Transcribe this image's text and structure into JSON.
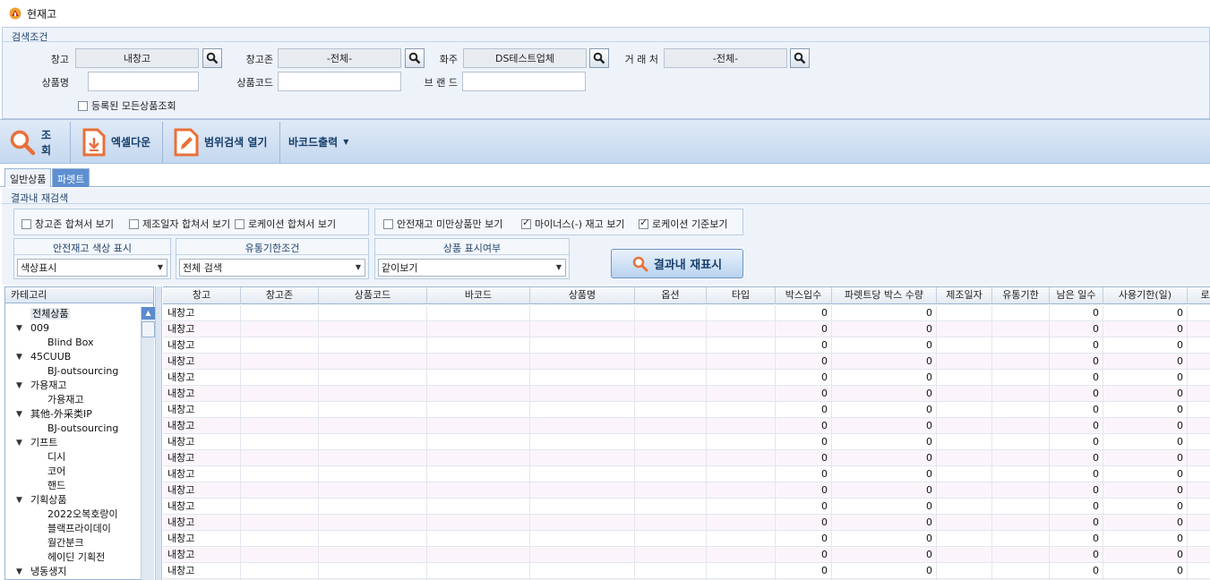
{
  "app": {
    "title": "현재고"
  },
  "search": {
    "caption": "검색조건",
    "warehouse_label": "창고",
    "warehouse_value": "내창고",
    "zone_label": "창고존",
    "zone_value": "-전체-",
    "owner_label": "화주",
    "owner_value": "DS테스트업체",
    "vendor_label": "거 래 처",
    "vendor_value": "-전체-",
    "product_name_label": "상품명",
    "product_name_value": "",
    "product_code_label": "상품코드",
    "product_code_value": "",
    "brand_label": "브 랜 드",
    "brand_value": "",
    "all_products_label": "등록된 모든상품조회"
  },
  "toolbar": {
    "search_label": "조회",
    "excel_label": "엑셀다운",
    "range_label": "범위검색 열기",
    "barcode_label": "바코드출력"
  },
  "tabs": [
    {
      "label": "일반상품"
    },
    {
      "label": "파렛트"
    }
  ],
  "filters": {
    "caption": "결과내 재검색",
    "merge_zone": "창고존 합쳐서 보기",
    "merge_mfg": "제조일자 합쳐서 보기",
    "merge_loc": "로케이션 합쳐서 보기",
    "under_safety": "안전재고 미만상품만 보기",
    "minus_stock": "마이너스(-) 재고 보기",
    "loc_based": "로케이션 기준보기",
    "safety_color_caption": "안전재고 색상 표시",
    "safety_color_value": "색상표시",
    "expiry_caption": "유통기한조건",
    "expiry_value": "전체 검색",
    "display_caption": "상품 표시여부",
    "display_value": "같이보기",
    "refresh_label": "결과내 재표시",
    "checked": {
      "merge_zone": false,
      "merge_mfg": false,
      "merge_loc": false,
      "under_safety": false,
      "minus_stock": true,
      "loc_based": true
    }
  },
  "category": {
    "header": "카테고리",
    "items": [
      {
        "label": "전체상품",
        "level": 0,
        "expanded": null
      },
      {
        "label": "009",
        "level": 0,
        "expanded": true
      },
      {
        "label": "Blind Box",
        "level": 1,
        "expanded": null
      },
      {
        "label": "45CUUB",
        "level": 0,
        "expanded": true
      },
      {
        "label": "BJ-outsourcing",
        "level": 1,
        "expanded": null
      },
      {
        "label": "가용재고",
        "level": 0,
        "expanded": true
      },
      {
        "label": "가용재고",
        "level": 1,
        "expanded": null
      },
      {
        "label": "其他-外采类IP",
        "level": 0,
        "expanded": true
      },
      {
        "label": "BJ-outsourcing",
        "level": 1,
        "expanded": null
      },
      {
        "label": "기프트",
        "level": 0,
        "expanded": true
      },
      {
        "label": "디시",
        "level": 1,
        "expanded": null
      },
      {
        "label": "코어",
        "level": 1,
        "expanded": null
      },
      {
        "label": "핸드",
        "level": 1,
        "expanded": null
      },
      {
        "label": "기획상품",
        "level": 0,
        "expanded": true
      },
      {
        "label": "2022오복호랑이",
        "level": 1,
        "expanded": null
      },
      {
        "label": "블랙프라이데이",
        "level": 1,
        "expanded": null
      },
      {
        "label": "월간분크",
        "level": 1,
        "expanded": null
      },
      {
        "label": "헤이딘 기획전",
        "level": 1,
        "expanded": null
      },
      {
        "label": "냉동생지",
        "level": 0,
        "expanded": true
      }
    ]
  },
  "grid": {
    "columns": [
      "창고",
      "창고존",
      "상품코드",
      "바코드",
      "상품명",
      "옵션",
      "타입",
      "박스입수",
      "파렛트당 박스 수량",
      "제조일자",
      "유통기한",
      "남은 일수",
      "사용기한(일)",
      "로"
    ],
    "rows": [
      [
        "내창고",
        "",
        "",
        "",
        "",
        "",
        "",
        "0",
        "0",
        "",
        "",
        "0",
        "0",
        ""
      ],
      [
        "내창고",
        "",
        "",
        "",
        "",
        "",
        "",
        "0",
        "0",
        "",
        "",
        "0",
        "0",
        ""
      ],
      [
        "내창고",
        "",
        "",
        "",
        "",
        "",
        "",
        "0",
        "0",
        "",
        "",
        "0",
        "0",
        ""
      ],
      [
        "내창고",
        "",
        "",
        "",
        "",
        "",
        "",
        "0",
        "0",
        "",
        "",
        "0",
        "0",
        ""
      ],
      [
        "내창고",
        "",
        "",
        "",
        "",
        "",
        "",
        "0",
        "0",
        "",
        "",
        "0",
        "0",
        ""
      ],
      [
        "내창고",
        "",
        "",
        "",
        "",
        "",
        "",
        "0",
        "0",
        "",
        "",
        "0",
        "0",
        ""
      ],
      [
        "내창고",
        "",
        "",
        "",
        "",
        "",
        "",
        "0",
        "0",
        "",
        "",
        "0",
        "0",
        ""
      ],
      [
        "내창고",
        "",
        "",
        "",
        "",
        "",
        "",
        "0",
        "0",
        "",
        "",
        "0",
        "0",
        ""
      ],
      [
        "내창고",
        "",
        "",
        "",
        "",
        "",
        "",
        "0",
        "0",
        "",
        "",
        "0",
        "0",
        ""
      ],
      [
        "내창고",
        "",
        "",
        "",
        "",
        "",
        "",
        "0",
        "0",
        "",
        "",
        "0",
        "0",
        ""
      ],
      [
        "내창고",
        "",
        "",
        "",
        "",
        "",
        "",
        "0",
        "0",
        "",
        "",
        "0",
        "0",
        ""
      ],
      [
        "내창고",
        "",
        "",
        "",
        "",
        "",
        "",
        "0",
        "0",
        "",
        "",
        "0",
        "0",
        ""
      ],
      [
        "내창고",
        "",
        "",
        "",
        "",
        "",
        "",
        "0",
        "0",
        "",
        "",
        "0",
        "0",
        ""
      ],
      [
        "내창고",
        "",
        "",
        "",
        "",
        "",
        "",
        "0",
        "0",
        "",
        "",
        "0",
        "0",
        ""
      ],
      [
        "내창고",
        "",
        "",
        "",
        "",
        "",
        "",
        "0",
        "0",
        "",
        "",
        "0",
        "0",
        ""
      ],
      [
        "내창고",
        "",
        "",
        "",
        "",
        "",
        "",
        "0",
        "0",
        "",
        "",
        "0",
        "0",
        ""
      ],
      [
        "내창고",
        "",
        "",
        "",
        "",
        "",
        "",
        "0",
        "0",
        "",
        "",
        "0",
        "0",
        ""
      ],
      [
        "내창고",
        "",
        "",
        "",
        "",
        "",
        "",
        "0",
        "0",
        "",
        "",
        "0",
        "0",
        ""
      ]
    ]
  },
  "colors": {
    "accent": "#5d8fd1",
    "panel": "#eef3fa",
    "toolbar": "#c5d8ef",
    "icon_orange": "#e8703a"
  }
}
